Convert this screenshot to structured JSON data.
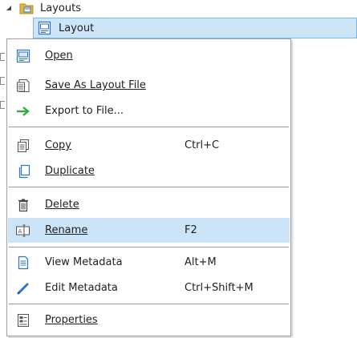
{
  "tree": {
    "parent_label": "Layouts",
    "child_label": "Layout"
  },
  "menu": {
    "items": [
      {
        "label": "Open",
        "shortcut": "",
        "icon": "open-layout-icon"
      },
      {
        "label": "Save As Layout File",
        "shortcut": "",
        "icon": "save-layout-file-icon"
      },
      {
        "label": "Export to File...",
        "shortcut": "",
        "icon": "export-arrow-icon"
      },
      {
        "label": "Copy",
        "shortcut": "Ctrl+C",
        "icon": "copy-icon"
      },
      {
        "label": "Duplicate",
        "shortcut": "",
        "icon": "duplicate-icon"
      },
      {
        "label": "Delete",
        "shortcut": "",
        "icon": "trash-icon"
      },
      {
        "label": "Rename",
        "shortcut": "F2",
        "icon": "rename-icon"
      },
      {
        "label": "View Metadata",
        "shortcut": "Alt+M",
        "icon": "metadata-icon"
      },
      {
        "label": "Edit Metadata",
        "shortcut": "Ctrl+Shift+M",
        "icon": "pencil-icon"
      },
      {
        "label": "Properties",
        "shortcut": "",
        "icon": "properties-icon"
      }
    ],
    "highlighted_item": "Rename"
  },
  "colors": {
    "highlight": "#cce4f7",
    "selection": "#cde6f7",
    "export_arrow": "#3aa83a",
    "edit_pencil": "#2f73c9",
    "folder": "#e8b53c"
  }
}
